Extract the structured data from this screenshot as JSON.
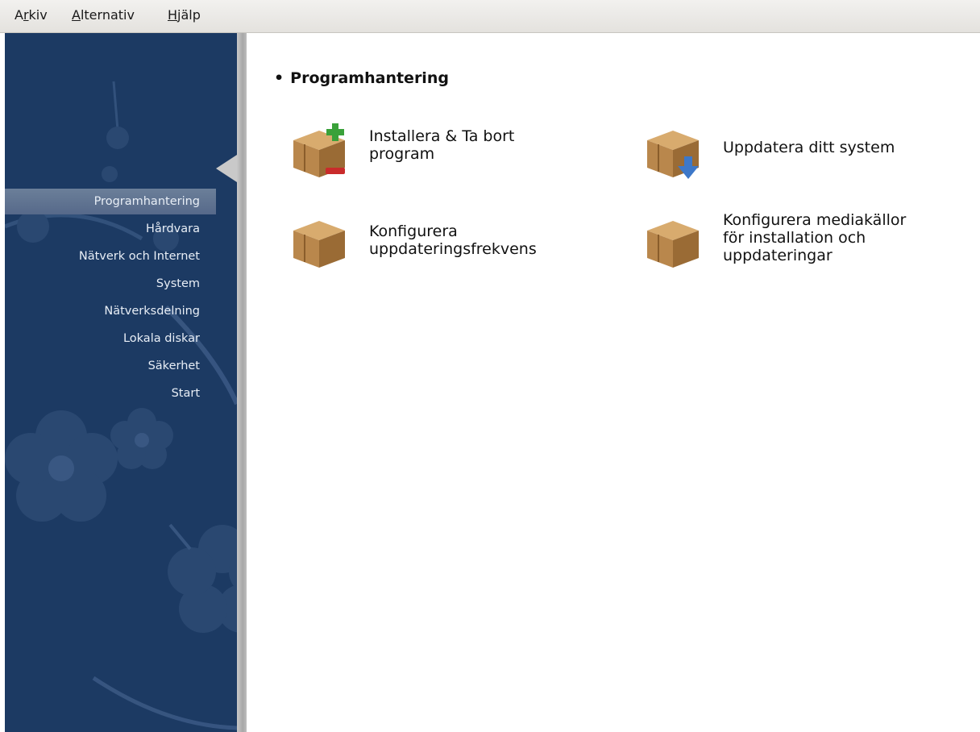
{
  "menubar": {
    "items": [
      {
        "pre": "A",
        "u": "r",
        "post": "kiv"
      },
      {
        "pre": "",
        "u": "A",
        "post": "lternativ"
      },
      {
        "pre": "",
        "u": "H",
        "post": "jälp"
      }
    ]
  },
  "sidebar": {
    "items": [
      {
        "label": "Programhantering",
        "active": true
      },
      {
        "label": "Hårdvara"
      },
      {
        "label": "Nätverk och Internet"
      },
      {
        "label": "System"
      },
      {
        "label": "Nätverksdelning"
      },
      {
        "label": "Lokala diskar"
      },
      {
        "label": "Säkerhet"
      },
      {
        "label": "Start"
      }
    ]
  },
  "content": {
    "section_title": "Programhantering",
    "tiles": [
      {
        "line1": "Installera & Ta bort",
        "line2": "program",
        "line3": "",
        "icon": "package-add-remove-icon"
      },
      {
        "line1": "Uppdatera ditt system",
        "line2": "",
        "line3": "",
        "icon": "package-update-icon"
      },
      {
        "line1": "Konfigurera",
        "line2": "uppdateringsfrekvens",
        "line3": "",
        "icon": "package-icon"
      },
      {
        "line1": "Konfigurera mediakällor",
        "line2": "för installation och",
        "line3": "uppdateringar",
        "icon": "package-icon"
      }
    ]
  },
  "colors": {
    "sidebar_bg": "#1c3a63",
    "sidebar_active": "#5f7393",
    "box_brown": "#b9874c"
  }
}
